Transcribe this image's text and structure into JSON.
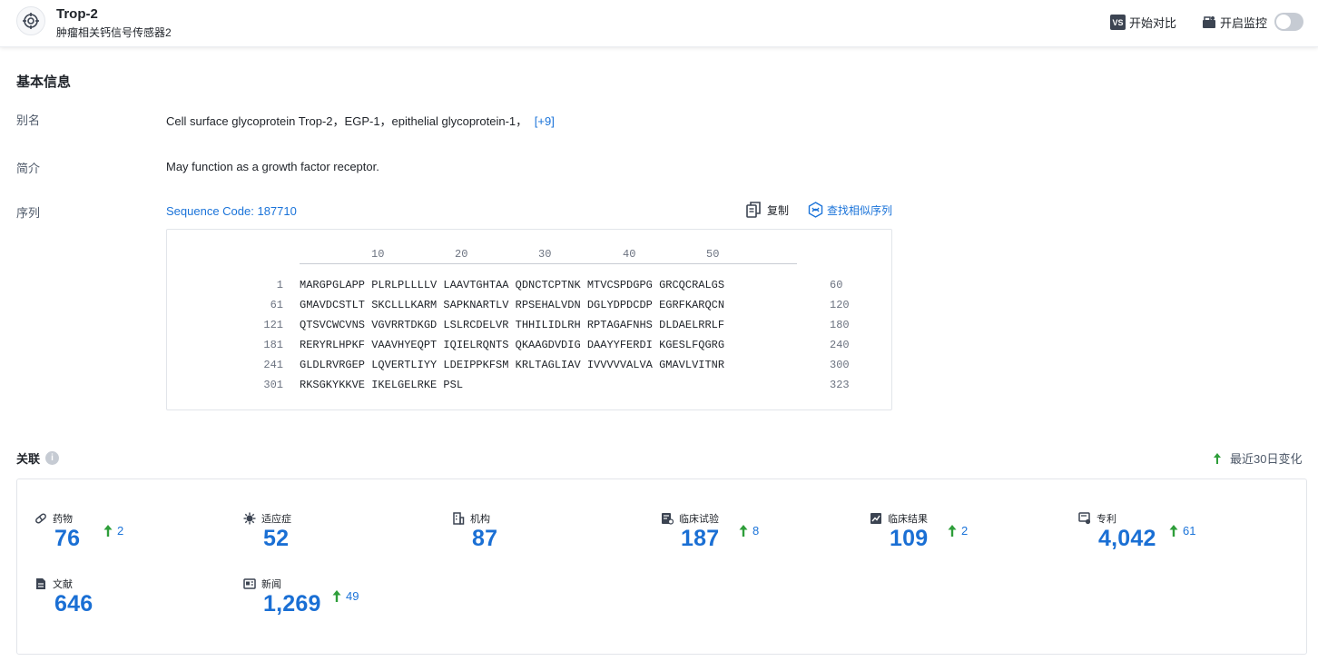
{
  "header": {
    "title": "Trop-2",
    "subtitle": "肿瘤相关钙信号传感器2",
    "compare_label": "开始对比",
    "compare_badge": "VS",
    "monitor_label": "开启监控"
  },
  "basic_info": {
    "section_title": "基本信息",
    "alias_label": "别名",
    "alias_value": "Cell surface glycoprotein Trop-2，EGP-1，epithelial glycoprotein-1，",
    "alias_more": "[+9]",
    "intro_label": "简介",
    "intro_value": "May function as a growth factor receptor.",
    "sequence_label": "序列",
    "sequence_code": "Sequence Code: 187710",
    "copy_label": "复制",
    "find_similar_label": "查找相似序列"
  },
  "sequence": {
    "ruler": [
      "10",
      "20",
      "30",
      "40",
      "50"
    ],
    "rows": [
      {
        "start": "1",
        "text": "MARGPGLAPP PLRLPLLLLV LAAVTGHTAA QDNCTCPTNK MTVCSPDGPG GRCQCRALGS",
        "end": "60"
      },
      {
        "start": "61",
        "text": "GMAVDCSTLT SKCLLLKARM SAPKNARTLV RPSEHALVDN DGLYDPDCDP EGRFKARQCN",
        "end": "120"
      },
      {
        "start": "121",
        "text": "QTSVCWCVNS VGVRRTDKGD LSLRCDELVR THHILIDLRH RPTAGAFNHS DLDAELRRLF",
        "end": "180"
      },
      {
        "start": "181",
        "text": "RERYRLHPKF VAAVHYEQPT IQIELRQNTS QKAAGDVDIG DAAYYFERDI KGESLFQGRG",
        "end": "240"
      },
      {
        "start": "241",
        "text": "GLDLRVRGEP LQVERTLIYY LDEIPPKFSM KRLTAGLIAV IVVVVVALVA GMAVLVITNR",
        "end": "300"
      },
      {
        "start": "301",
        "text": "RKSGKYKKVE IKELGELRKE PSL",
        "end": "323"
      }
    ]
  },
  "relations": {
    "section_title": "关联",
    "recent_change_label": "最近30日变化",
    "accent_color": "#1a6fd4",
    "up_color": "#2e9e3a",
    "stats": [
      {
        "label": "药物",
        "icon": "pill-icon",
        "value": "76",
        "delta": "2"
      },
      {
        "label": "适应症",
        "icon": "virus-icon",
        "value": "52",
        "delta": ""
      },
      {
        "label": "机构",
        "icon": "building-icon",
        "value": "87",
        "delta": ""
      },
      {
        "label": "临床试验",
        "icon": "clinical-trial-icon",
        "value": "187",
        "delta": "8"
      },
      {
        "label": "临床结果",
        "icon": "clinical-result-icon",
        "value": "109",
        "delta": "2"
      },
      {
        "label": "专利",
        "icon": "patent-icon",
        "value": "4,042",
        "delta": "61"
      },
      {
        "label": "文献",
        "icon": "document-icon",
        "value": "646",
        "delta": ""
      },
      {
        "label": "新闻",
        "icon": "news-icon",
        "value": "1,269",
        "delta": "49"
      }
    ]
  }
}
